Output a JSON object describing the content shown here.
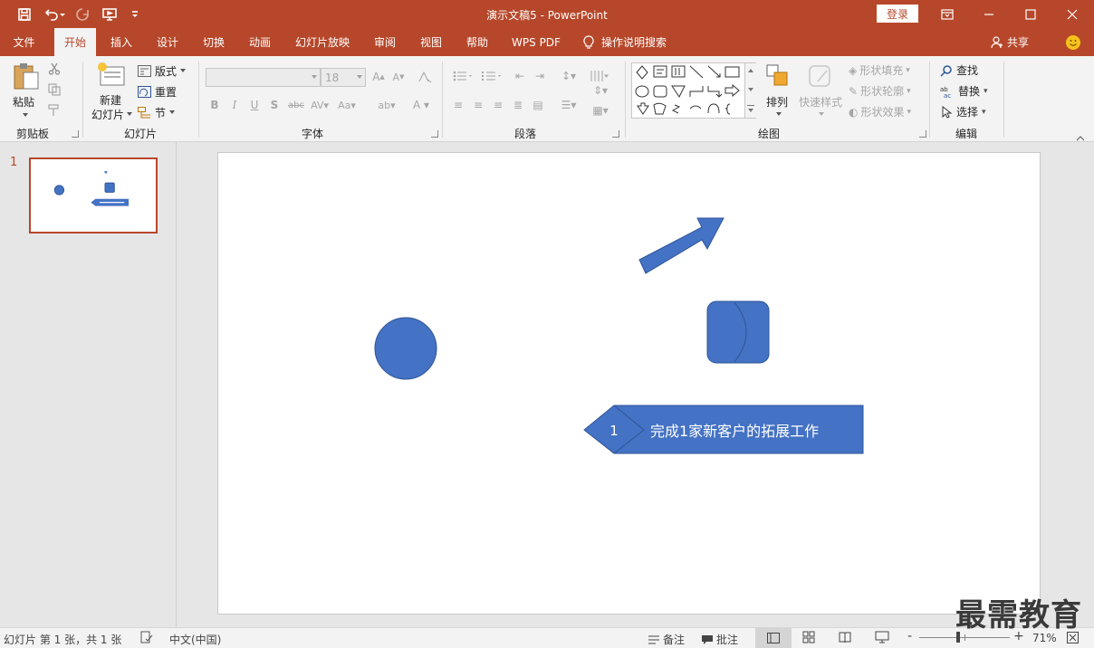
{
  "window": {
    "title": "演示文稿5  -  PowerPoint",
    "login_label": "登录"
  },
  "tabs": [
    {
      "label": "文件"
    },
    {
      "label": "开始"
    },
    {
      "label": "插入"
    },
    {
      "label": "设计"
    },
    {
      "label": "切换"
    },
    {
      "label": "动画"
    },
    {
      "label": "幻灯片放映"
    },
    {
      "label": "审阅"
    },
    {
      "label": "视图"
    },
    {
      "label": "帮助"
    },
    {
      "label": "WPS PDF"
    },
    {
      "label": "操作说明搜索"
    }
  ],
  "active_tab": "开始",
  "share_label": "共享",
  "ribbon": {
    "clipboard": {
      "paste_label": "粘贴",
      "group_label": "剪贴板"
    },
    "slides": {
      "new_slide_line1": "新建",
      "new_slide_line2": "幻灯片",
      "layout_label": "版式",
      "reset_label": "重置",
      "section_label": "节",
      "group_label": "幻灯片"
    },
    "font": {
      "size_value": "18",
      "group_label": "字体"
    },
    "paragraph": {
      "group_label": "段落"
    },
    "drawing": {
      "arrange_label": "排列",
      "quick_styles_label": "快速样式",
      "fill_label": "形状填充",
      "outline_label": "形状轮廓",
      "effects_label": "形状效果",
      "group_label": "绘图"
    },
    "editing": {
      "find_label": "查找",
      "replace_label": "替换",
      "select_label": "选择",
      "group_label": "编辑"
    }
  },
  "thumbnails": [
    {
      "number": "1"
    }
  ],
  "slide": {
    "callout_number": "1",
    "callout_text": "完成1家新客户的拓展工作",
    "shape_color": "#4472c4"
  },
  "status": {
    "slide_info": "幻灯片 第 1 张，共 1 张",
    "language": "中文(中国)",
    "notes_label": "备注",
    "comments_label": "批注",
    "zoom_minus": "-",
    "zoom_plus": "+",
    "zoom": "71%",
    "zoom_fraction": 0.43
  },
  "watermark": "最需教育",
  "colors": {
    "accent": "#b7472a",
    "ribbon_bg": "#f3f3f3",
    "shape": "#4472c4"
  }
}
